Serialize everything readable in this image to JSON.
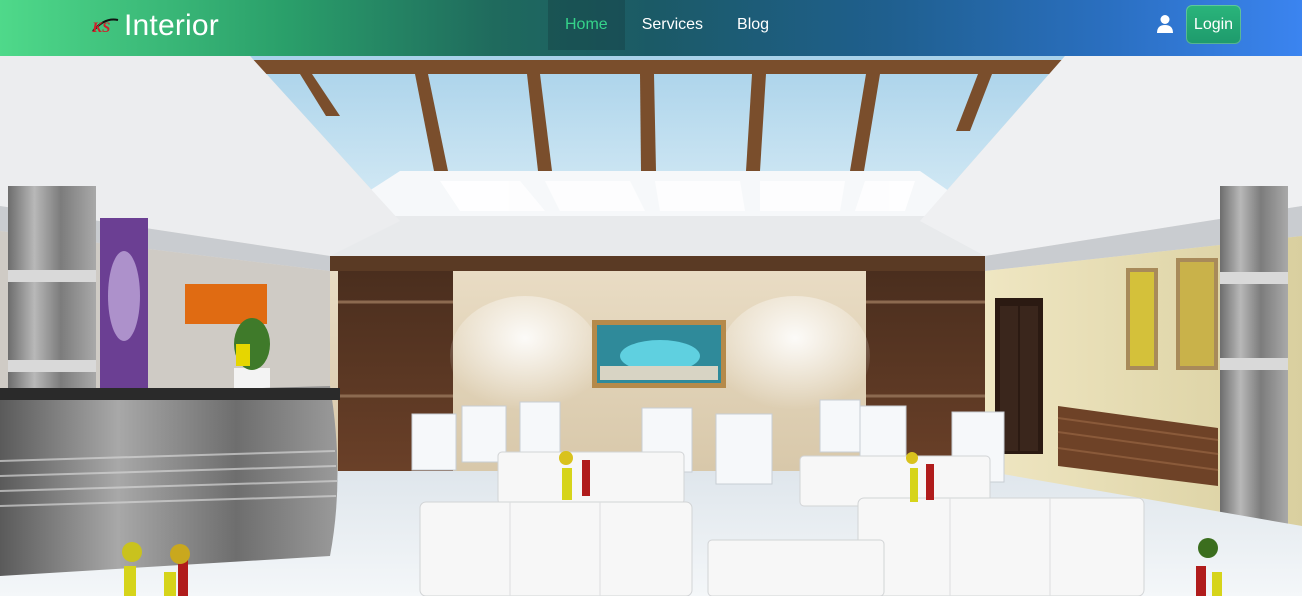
{
  "navbar": {
    "brand": {
      "logo_text": "KS",
      "name": "Interior"
    },
    "links": [
      {
        "label": "Home",
        "active": true
      },
      {
        "label": "Services",
        "active": false
      },
      {
        "label": "Blog",
        "active": false
      }
    ],
    "user_icon": "user-icon",
    "login_label": "Login",
    "colors": {
      "gradient_start": "#4fd98a",
      "gradient_end": "#3b84f0",
      "active_link": "#35d48a",
      "login_button": "#1e9a6c"
    }
  },
  "hero": {
    "scene": "hotel-lounge-interior"
  }
}
